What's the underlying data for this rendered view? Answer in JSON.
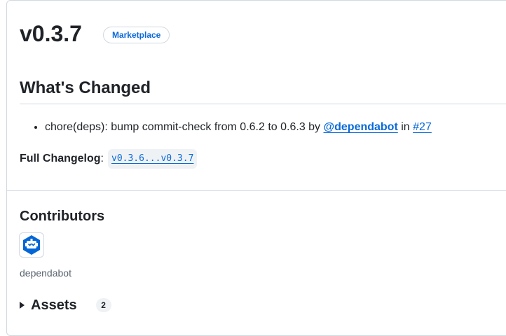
{
  "release": {
    "version": "v0.3.7",
    "badge": "Marketplace"
  },
  "changes": {
    "title": "What's Changed",
    "items": [
      {
        "text": "chore(deps): bump commit-check from 0.6.2 to 0.6.3 by",
        "user": "@dependabot",
        "connector": "in",
        "pr": "#27"
      }
    ]
  },
  "changelog": {
    "label": "Full Changelog",
    "separator": ":",
    "range": "v0.3.6...v0.3.7"
  },
  "contributors": {
    "title": "Contributors",
    "items": [
      {
        "name": "dependabot",
        "avatar_icon": "dependabot-bot-icon",
        "avatar_color": "#0366d6"
      }
    ]
  },
  "assets": {
    "title": "Assets",
    "count": "2",
    "expand_icon": "triangle-right-icon"
  }
}
